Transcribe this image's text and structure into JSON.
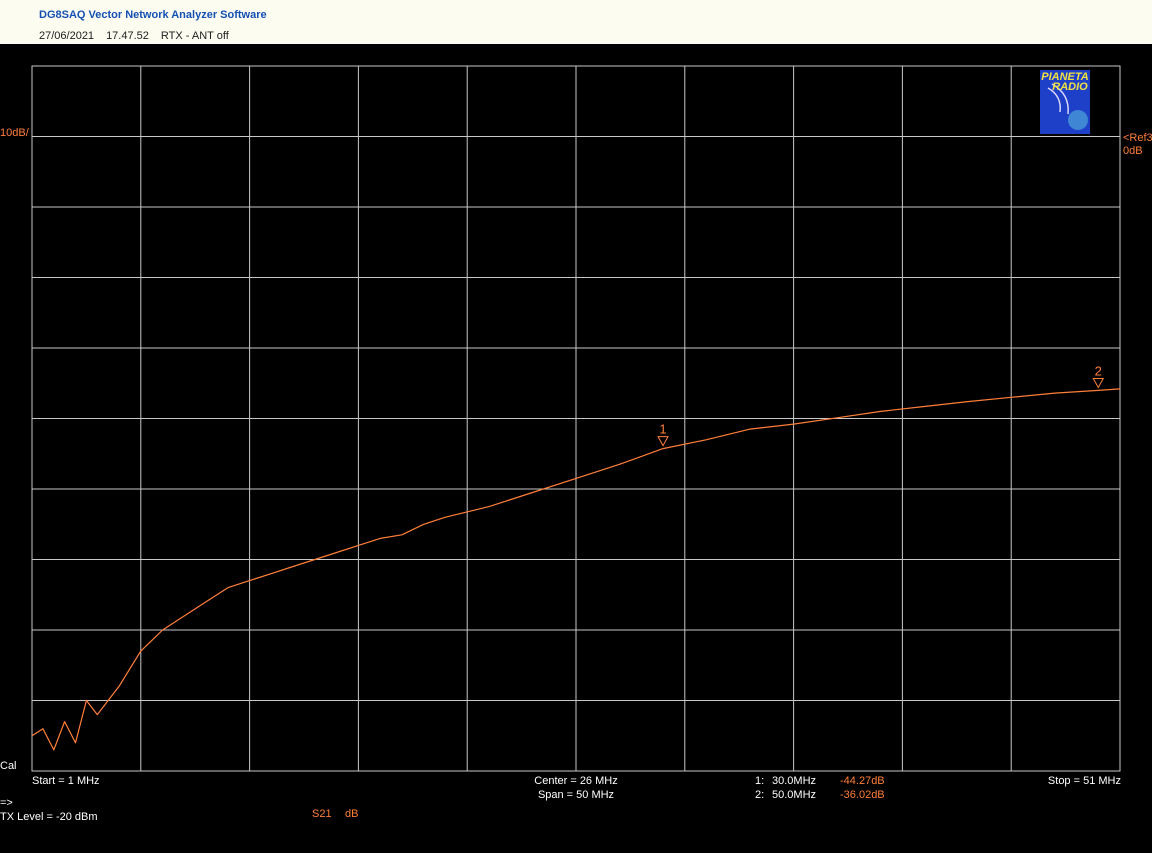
{
  "header": {
    "app_title": "DG8SAQ Vector Network Analyzer Software",
    "date": "27/06/2021",
    "time": "17.47.52",
    "status": "RTX - ANT off"
  },
  "logo": {
    "line1": "PIANETA",
    "line2": "RADIO"
  },
  "labels": {
    "scale": "10dB/",
    "ref_line1": "<Ref3",
    "ref_line2": "0dB",
    "cal": "Cal",
    "start": "Start = 1 MHz",
    "center": "Center = 26 MHz",
    "span": "Span = 50 MHz",
    "stop": "Stop = 51 MHz",
    "arrow": "=>",
    "tx_level": "TX Level = -20 dBm",
    "trace_name": "S21",
    "trace_unit": "dB"
  },
  "markers": [
    {
      "id": "1",
      "label": "1:",
      "freq": "30.0MHz",
      "value": "-44.27dB",
      "x": 30.0,
      "y": -44.27
    },
    {
      "id": "2",
      "label": "2:",
      "freq": "50.0MHz",
      "value": "-36.02dB",
      "x": 50.0,
      "y": -36.02
    }
  ],
  "colors": {
    "trace": "#ff7f3a",
    "grid": "#c8c8c8",
    "background": "#000000",
    "header_title": "#1450b4"
  },
  "chart_data": {
    "type": "line",
    "xlim": [
      1,
      51
    ],
    "ylim": [
      -90,
      10
    ],
    "x_divisions": 10,
    "y_divisions": 10,
    "grid": true,
    "series": [
      {
        "name": "S21",
        "x": [
          1,
          1.5,
          2,
          2.5,
          3,
          3.5,
          4,
          5,
          6,
          7,
          8,
          9,
          10,
          11,
          12,
          13,
          14,
          15,
          16,
          17,
          18,
          19,
          20,
          22,
          24,
          26,
          28,
          30,
          32,
          34,
          36,
          38,
          40,
          42,
          44,
          46,
          48,
          50,
          51
        ],
        "y": [
          -85,
          -84,
          -87,
          -83,
          -86,
          -80,
          -82,
          -78,
          -73,
          -70,
          -68,
          -66,
          -64,
          -63,
          -62,
          -61,
          -60,
          -59,
          -58,
          -57,
          -56.5,
          -55,
          -54,
          -52.5,
          -50.5,
          -48.5,
          -46.5,
          -44.27,
          -43,
          -41.5,
          -40.8,
          -39.9,
          -39,
          -38.3,
          -37.6,
          -37,
          -36.4,
          -36.02,
          -35.8
        ]
      }
    ]
  }
}
